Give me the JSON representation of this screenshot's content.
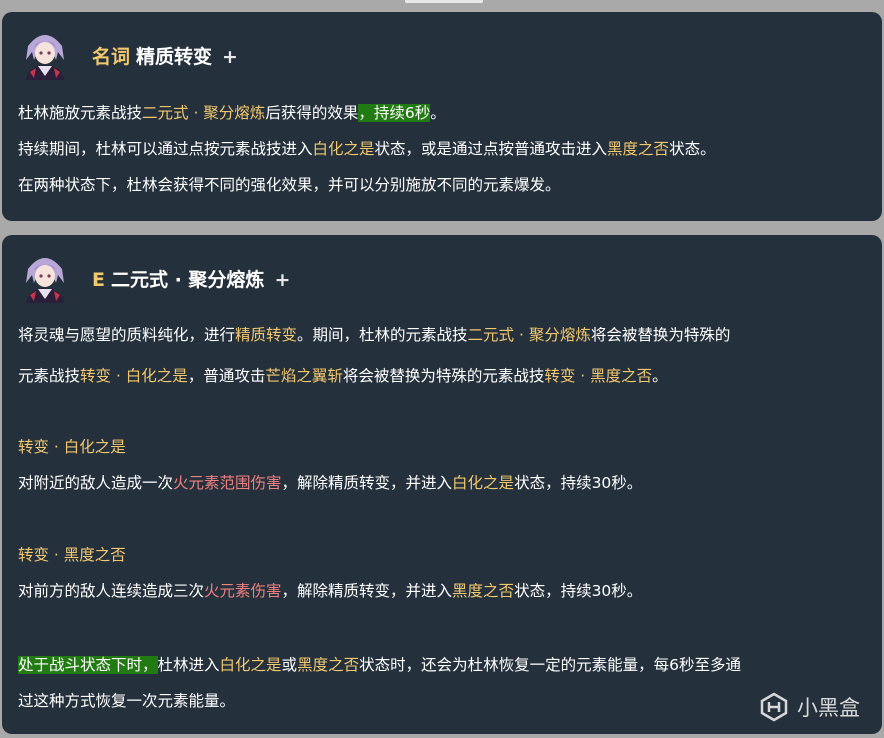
{
  "card1": {
    "tag": "名词",
    "title": "精质转变",
    "plus": "+",
    "line1": {
      "a": "杜林施放元素战技",
      "b": "二元式 · 聚分熔炼",
      "c": "后获得的效果",
      "d": "，持续6秒",
      "e": "。"
    },
    "line2": {
      "a": "持续期间，杜林可以通过点按元素战技进入",
      "b": "白化之是",
      "c": "状态，或是通过点按普通攻击进入",
      "d": "黑度之否",
      "e": "状态。"
    },
    "line3": "在两种状态下，杜林会获得不同的强化效果，并可以分别施放不同的元素爆发。"
  },
  "card2": {
    "tag": "E",
    "title": "二元式 · 聚分熔炼",
    "plus": "+",
    "p1l1": {
      "a": "将灵魂与愿望的质料纯化，进行",
      "b": "精质转变",
      "c": "。期间，杜林的元素战技",
      "d": "二元式 · 聚分熔炼",
      "e": "将会被替换为特殊的"
    },
    "p1l2": {
      "a": "元素战技",
      "b": "转变 · 白化之是",
      "c": "，普通攻击",
      "d": "芒焰之翼斩",
      "e": "将会被替换为特殊的元素战技",
      "f": "转变 · 黑度之否",
      "g": "。"
    },
    "h1": "转变 · 白化之是",
    "p2": {
      "a": "对附近的敌人造成一次",
      "b": "火元素范围伤害",
      "c": "，解除精质转变，并进入",
      "d": "白化之是",
      "e": "状态，持续30秒。"
    },
    "h2": "转变 · 黑度之否",
    "p3": {
      "a": "对前方的敌人连续造成三次",
      "b": "火元素伤害",
      "c": "，解除精质转变，并进入",
      "d": "黑度之否",
      "e": "状态，持续30秒。"
    },
    "p4l1": {
      "a": "处于战斗状态下时，",
      "b": "杜林进入",
      "c": "白化之是",
      "d": "或",
      "e": "黑度之否",
      "f": "状态时，还会为杜林恢复一定的元素能量，每6秒至多通"
    },
    "p4l2": "过这种方式恢复一次元素能量。"
  },
  "watermark": {
    "text": "小黑盒",
    "icon": "heybox-logo-icon"
  },
  "avatar_icon": "character-portrait-icon",
  "colors": {
    "card_bg": "#24303b",
    "highlight_yellow": "#f2c86f",
    "highlight_red": "#f08080",
    "highlight_green": "#227a12",
    "page_bg": "#a9a9a9"
  }
}
